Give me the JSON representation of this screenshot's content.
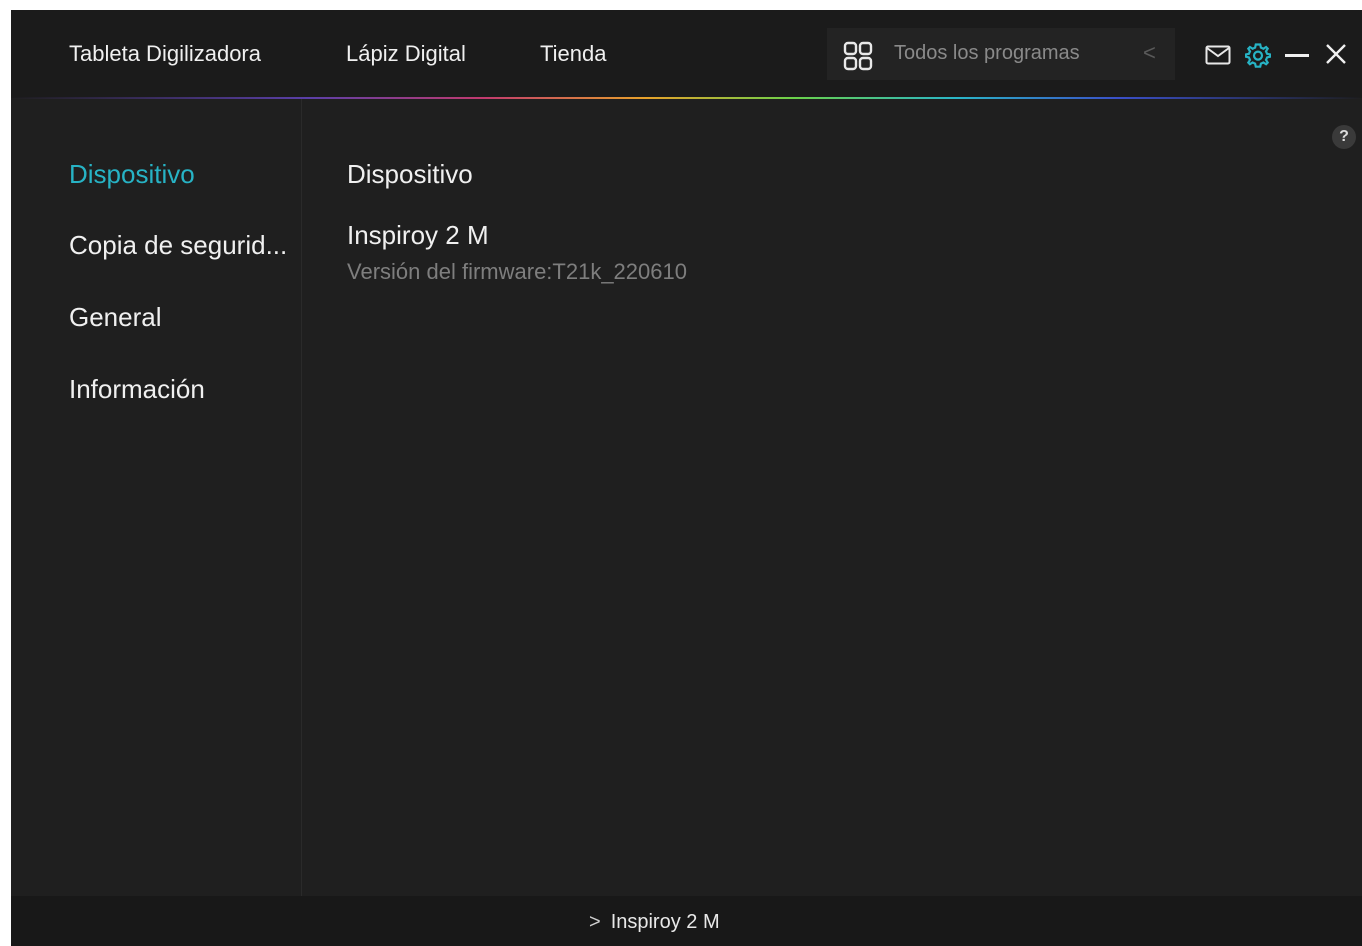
{
  "header": {
    "tabs": [
      {
        "label": "Tableta Digilizadora"
      },
      {
        "label": "Lápiz Digital"
      },
      {
        "label": "Tienda"
      }
    ],
    "program_selector": {
      "label": "Todos los programas",
      "icon": "grid-icon"
    },
    "icons": [
      "mail-icon",
      "gear-icon",
      "minimize-icon",
      "close-icon"
    ],
    "accent_color": "#27b3c5"
  },
  "sidebar": {
    "items": [
      {
        "label": "Dispositivo",
        "active": true
      },
      {
        "label": "Copia de segurid..."
      },
      {
        "label": "General"
      },
      {
        "label": "Información"
      }
    ]
  },
  "main": {
    "help_label": "?",
    "title": "Dispositivo",
    "device_name": "Inspiroy 2 M",
    "firmware": "Versión del firmware:T21k_220610"
  },
  "footer": {
    "chevron": ">",
    "device_label": "Inspiroy 2 M"
  }
}
